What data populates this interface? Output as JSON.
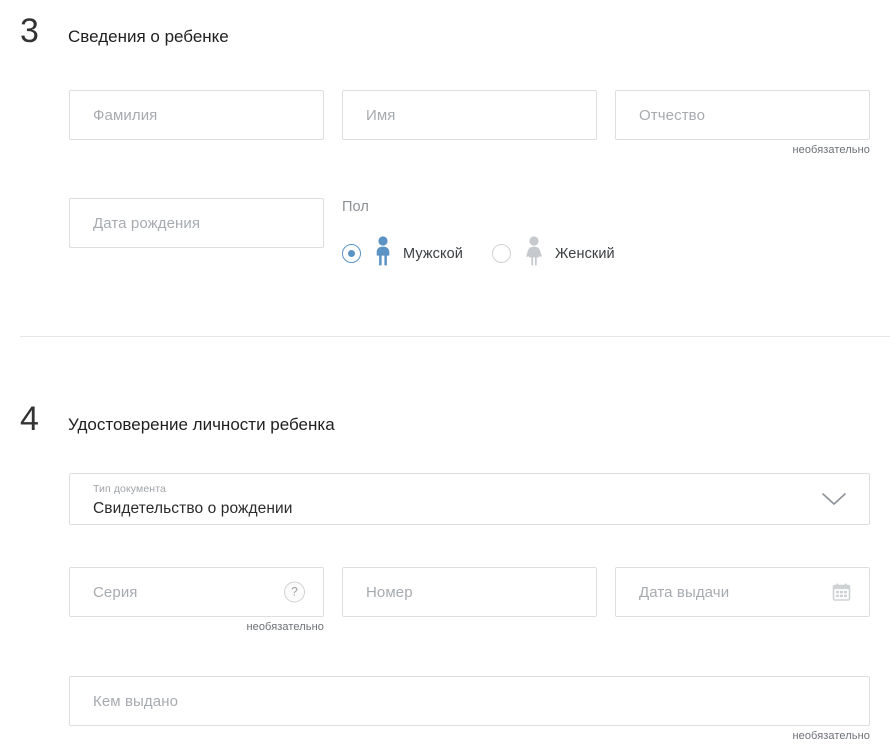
{
  "sections": [
    {
      "number": "3",
      "title": "Сведения о ребенке",
      "fields": {
        "surname_placeholder": "Фамилия",
        "firstname_placeholder": "Имя",
        "patronymic_placeholder": "Отчество",
        "patronymic_hint": "необязательно",
        "birthdate_placeholder": "Дата рождения"
      },
      "gender": {
        "label": "Пол",
        "options": [
          {
            "value": "male",
            "label": "Мужской",
            "selected": true,
            "icon": "male-person-icon",
            "color": "#5b93c5"
          },
          {
            "value": "female",
            "label": "Женский",
            "selected": false,
            "icon": "female-person-icon",
            "color": "#c6cace"
          }
        ]
      }
    },
    {
      "number": "4",
      "title": "Удостоверение личности ребенка",
      "doc_type": {
        "label": "Тип документа",
        "value": "Свидетельство о рождении",
        "icon": "chevron-down-icon"
      },
      "fields": {
        "series_placeholder": "Серия",
        "series_hint": "необязательно",
        "series_help_glyph": "?",
        "number_placeholder": "Номер",
        "issue_date_placeholder": "Дата выдачи",
        "issue_date_icon": "calendar-icon",
        "issued_by_placeholder": "Кем выдано",
        "issued_by_hint": "необязательно"
      }
    }
  ],
  "theme": {
    "border": "#dcdee0",
    "placeholder": "#a7abaf",
    "hint": "#6c7075",
    "accent": "#5b93c5",
    "divider": "#e4e6e8"
  }
}
